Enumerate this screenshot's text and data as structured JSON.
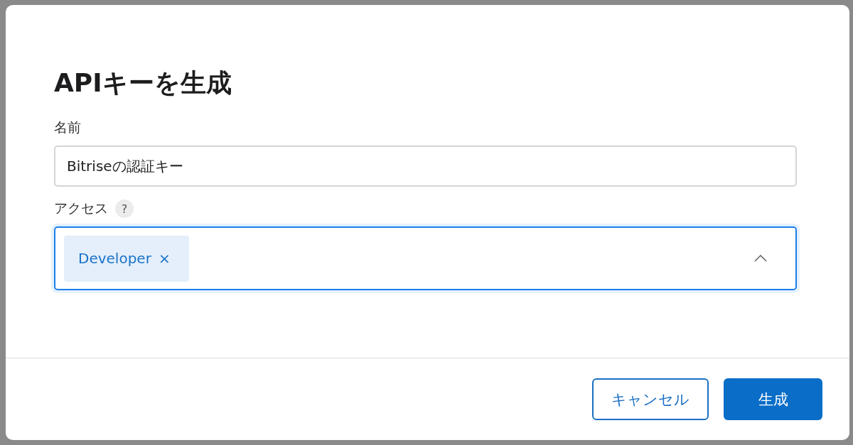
{
  "dialog": {
    "title": "APIキーを生成",
    "fields": [
      {
        "kind": "text",
        "label": "名前",
        "value": "Bitriseの認証キー"
      },
      {
        "kind": "multiselect",
        "label": "アクセス",
        "help": "?",
        "focused": true,
        "expanded": true,
        "chips": [
          {
            "label": "Developer",
            "remove": "×"
          }
        ]
      }
    ],
    "buttons": [
      {
        "label": "キャンセル",
        "kind": "secondary"
      },
      {
        "label": "生成",
        "kind": "primary"
      }
    ]
  }
}
